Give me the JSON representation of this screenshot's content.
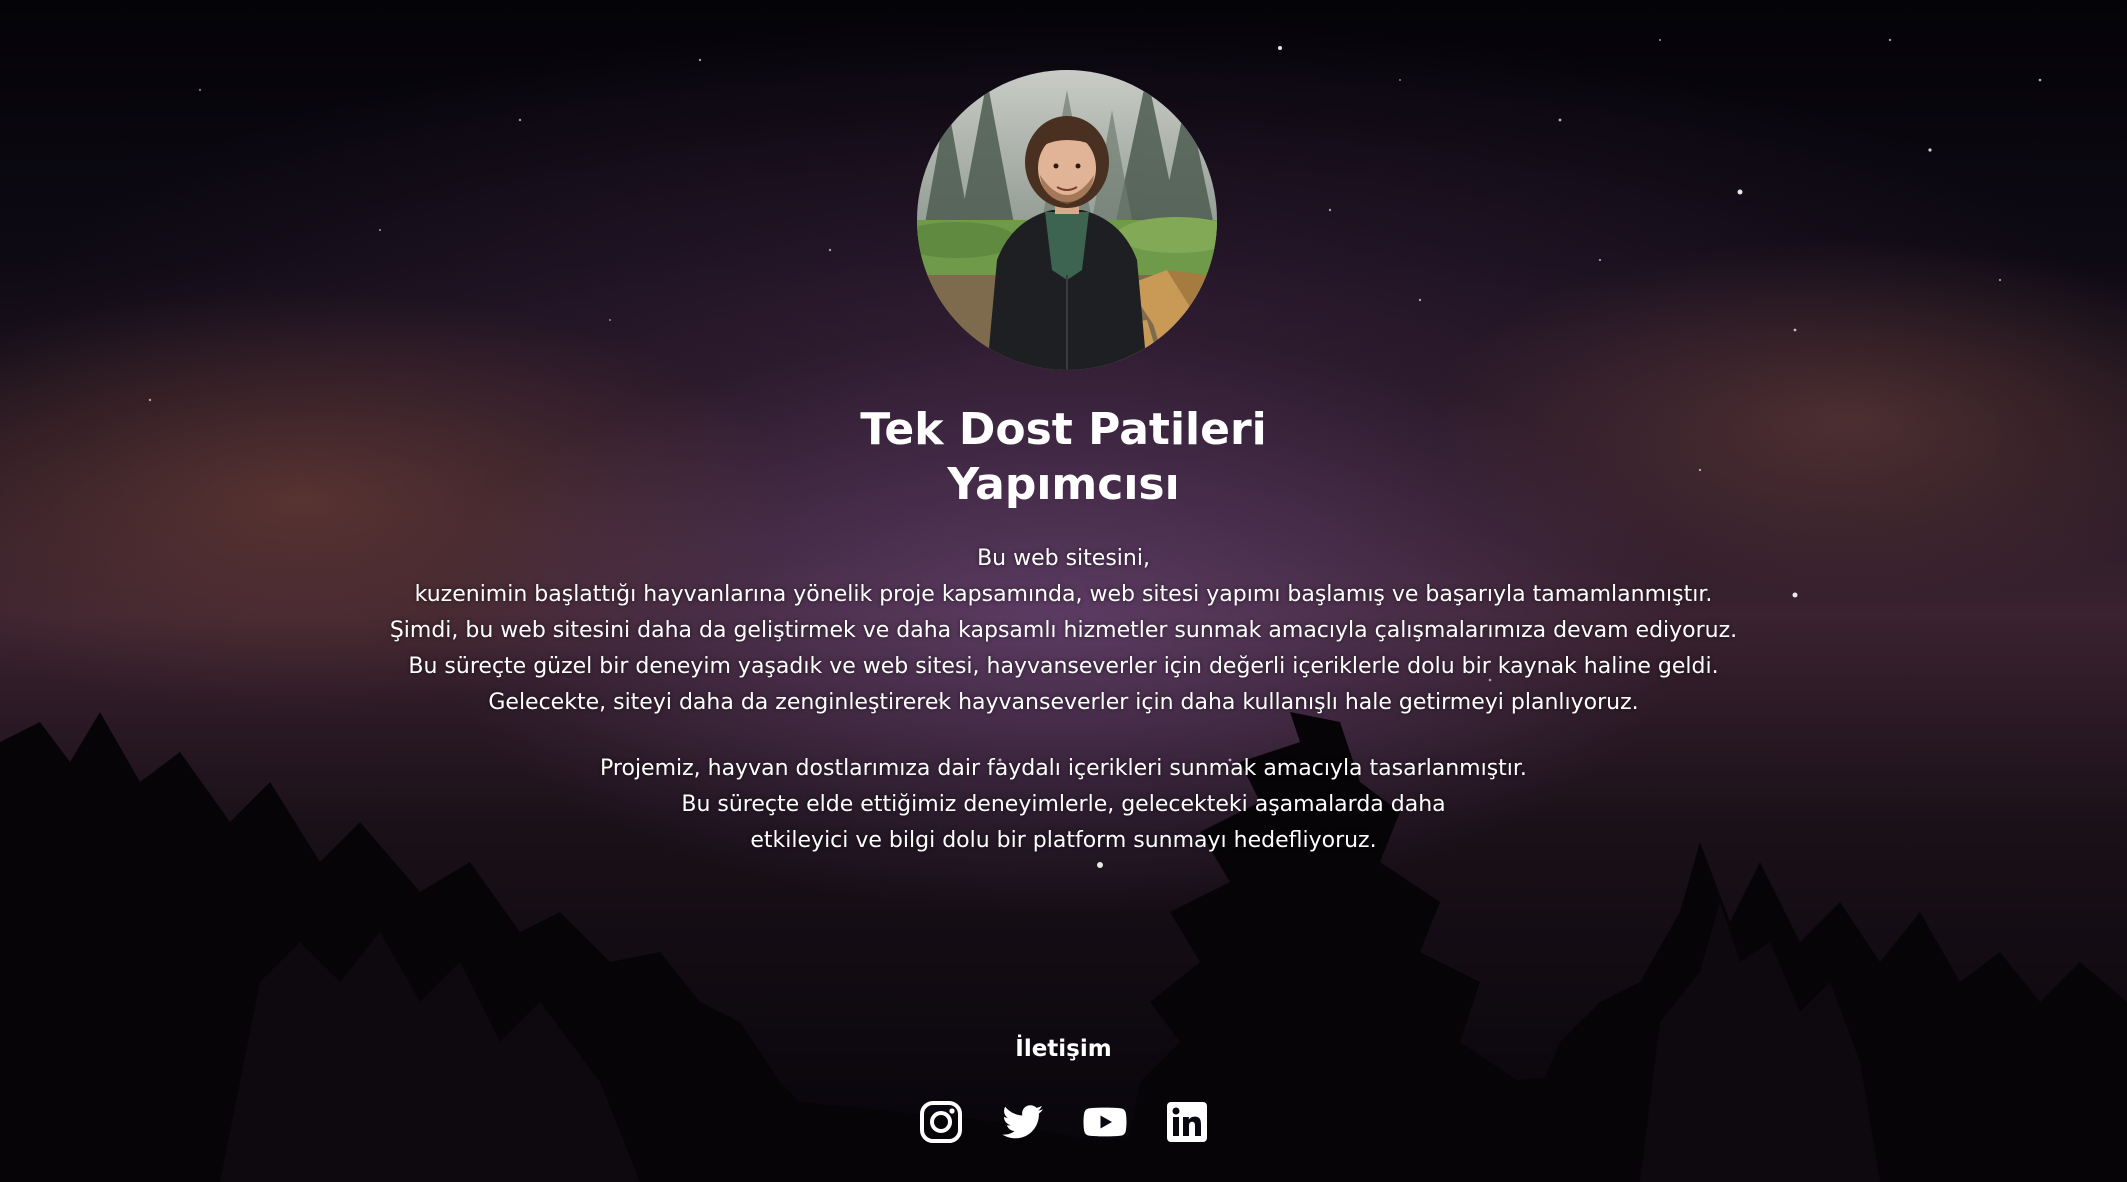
{
  "profile": {
    "avatar_alt": "avatar",
    "title_line1": "Tek Dost Patileri",
    "title_line2": "Yapımcısı"
  },
  "about": {
    "paragraph1": [
      "Bu web sitesini,",
      "kuzenimin başlattığı hayvanlarına yönelik proje kapsamında, web sitesi yapımı başlamış ve başarıyla tamamlanmıştır.",
      "Şimdi, bu web sitesini daha da geliştirmek ve daha kapsamlı hizmetler sunmak amacıyla çalışmalarımıza devam ediyoruz.",
      "Bu süreçte güzel bir deneyim yaşadık ve web sitesi, hayvanseverler için değerli içeriklerle dolu bir kaynak haline geldi.",
      "Gelecekte, siteyi daha da zenginleştirerek hayvanseverler için daha kullanışlı hale getirmeyi planlıyoruz."
    ],
    "paragraph2": [
      "Projemiz, hayvan dostlarımıza dair faydalı içerikleri sunmak amacıyla tasarlanmıştır.",
      "Bu süreçte elde ettiğimiz deneyimlerle, gelecekteki aşamalarda daha",
      "etkileyici ve bilgi dolu bir platform sunmayı hedefliyoruz."
    ]
  },
  "contact": {
    "title": "İletişim",
    "links": [
      {
        "icon": "instagram-icon"
      },
      {
        "icon": "twitter-icon"
      },
      {
        "icon": "youtube-icon"
      },
      {
        "icon": "linkedin-icon"
      }
    ]
  },
  "colors": {
    "text": "#ffffff",
    "background": "#05040a"
  }
}
